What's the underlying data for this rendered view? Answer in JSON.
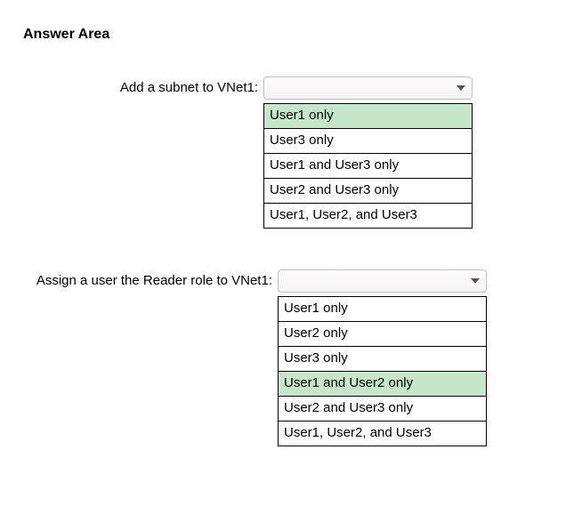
{
  "title": "Answer Area",
  "q1": {
    "label": "Add a subnet to VNet1:",
    "options": [
      {
        "text": "User1 only",
        "highlight": true
      },
      {
        "text": "User3 only",
        "highlight": false
      },
      {
        "text": "User1 and User3 only",
        "highlight": false
      },
      {
        "text": "User2 and User3 only",
        "highlight": false
      },
      {
        "text": "User1, User2, and User3",
        "highlight": false
      }
    ]
  },
  "q2": {
    "label": "Assign a user the Reader role to VNet1:",
    "options": [
      {
        "text": "User1 only",
        "highlight": false
      },
      {
        "text": "User2 only",
        "highlight": false
      },
      {
        "text": "User3 only",
        "highlight": false
      },
      {
        "text": "User1 and User2 only",
        "highlight": true
      },
      {
        "text": "User2 and User3 only",
        "highlight": false
      },
      {
        "text": "User1, User2, and User3",
        "highlight": false
      }
    ]
  }
}
